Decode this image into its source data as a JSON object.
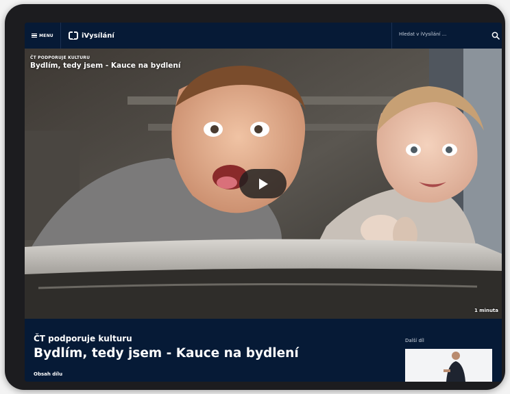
{
  "header": {
    "menu_label": "MENU",
    "logo_text": "iVysílání",
    "search_placeholder": "Hledat v iVysílání ..."
  },
  "video": {
    "kicker": "ČT PODPORUJE KULTURU",
    "title": "Bydlím, tedy jsem - Kauce na bydlení",
    "duration": "1 minuta"
  },
  "episode": {
    "show_name": "ČT podporuje kulturu",
    "title": "Bydlím, tedy jsem - Kauce na bydlení",
    "tab_label": "Obsah dílu"
  },
  "next": {
    "label": "Další díl"
  },
  "icons": {
    "menu": "hamburger-icon",
    "search": "search-icon",
    "play": "play-icon",
    "logo": "ct-logo-icon"
  },
  "colors": {
    "brand_background": "#061a36",
    "text": "#ffffff",
    "device_frame": "#1c1c1f"
  }
}
